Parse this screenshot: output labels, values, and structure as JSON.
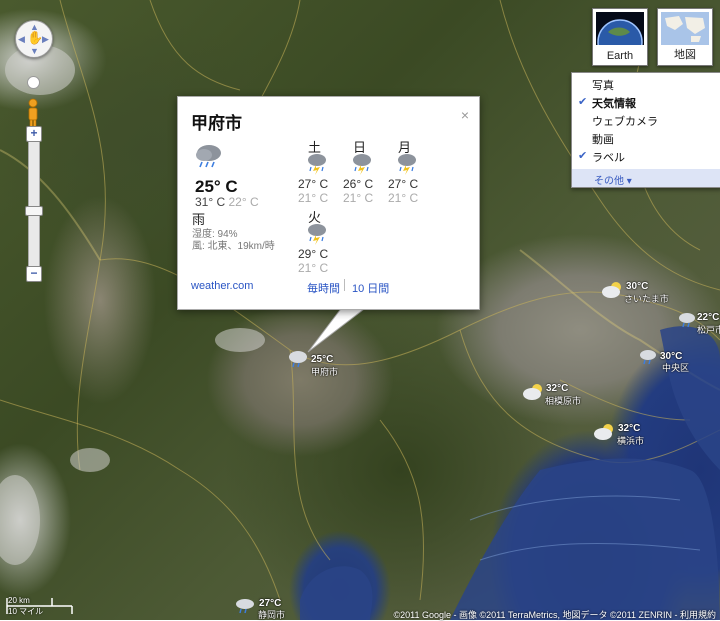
{
  "info_window": {
    "city": "甲府市",
    "current": {
      "icon": "rain-cloud-icon",
      "temp": "25° C",
      "high": "31° C",
      "low": "22° C",
      "condition": "雨",
      "humidity": "湿度: 94%",
      "wind": "風: 北東、19km/時"
    },
    "forecast": [
      {
        "day": "土",
        "high": "27° C",
        "low": "21° C",
        "icon": "thunderstorm-icon"
      },
      {
        "day": "日",
        "high": "26° C",
        "low": "21° C",
        "icon": "thunderstorm-icon"
      },
      {
        "day": "月",
        "high": "27° C",
        "low": "21° C",
        "icon": "thunderstorm-icon"
      },
      {
        "day": "火",
        "high": "29° C",
        "low": "21° C",
        "icon": "thunderstorm-icon"
      }
    ],
    "links": {
      "source": "weather.com",
      "hourly": "毎時間",
      "ten_day": "10 日間"
    },
    "close": "×"
  },
  "map_types": [
    {
      "label": "Earth",
      "icon": "earth-icon"
    },
    {
      "label": "地図",
      "icon": "map-icon"
    }
  ],
  "layers_menu": {
    "items": [
      {
        "label": "写真",
        "checked": false
      },
      {
        "label": "天気情報",
        "checked": true
      },
      {
        "label": "ウェブカメラ",
        "checked": false
      },
      {
        "label": "動画",
        "checked": false
      },
      {
        "label": "ラベル",
        "checked": true
      }
    ],
    "more": "その他 ▾",
    "check_glyph": "✔"
  },
  "weather_labels": [
    {
      "temp": "25°C",
      "city": "甲府市",
      "icon": "rain-icon"
    },
    {
      "temp": "30°C",
      "city": "さいたま市",
      "icon": "partly-cloudy-icon"
    },
    {
      "temp": "22°C",
      "city": "松戸市",
      "icon": "rain-icon"
    },
    {
      "temp": "30°C",
      "city": "中央区",
      "icon": "rain-icon"
    },
    {
      "temp": "32°C",
      "city": "相模原市",
      "icon": "partly-cloudy-icon"
    },
    {
      "temp": "32°C",
      "city": "横浜市",
      "icon": "partly-cloudy-icon"
    },
    {
      "temp": "27°C",
      "city": "静岡市",
      "icon": "rain-icon"
    }
  ],
  "scale": {
    "metric": "20 km",
    "imperial": "10 マイル"
  },
  "copyright": "©2011 Google - 画像 ©2011 TerraMetrics, 地図データ ©2011 ZENRIN - 利用規約"
}
